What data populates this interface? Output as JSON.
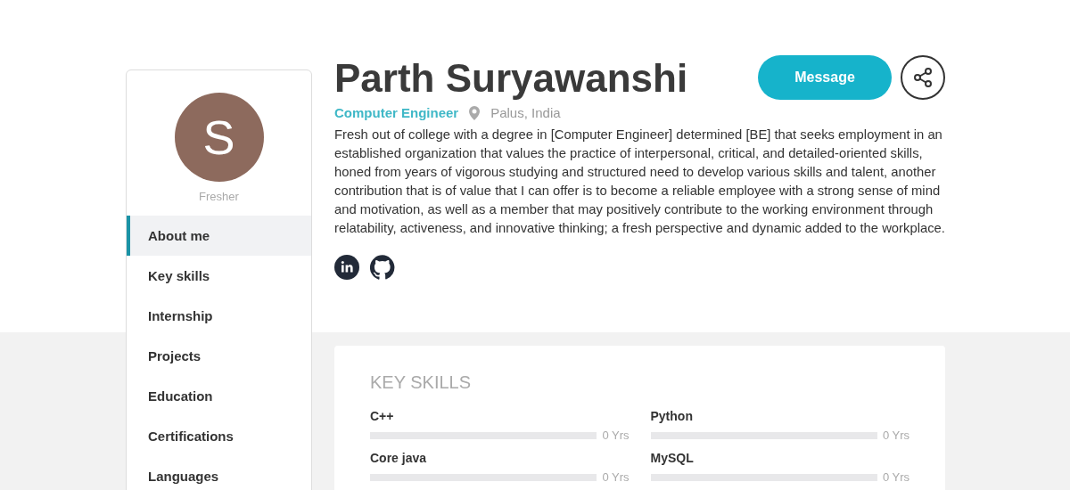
{
  "profile": {
    "avatar_letter": "S",
    "status": "Fresher",
    "name": "Parth Suryawanshi",
    "role": "Computer Engineer",
    "location": "Palus, India",
    "about": "Fresh out of college with a degree in [Computer Engineer] determined [BE] that seeks employment in an established organization that values the practice of interpersonal, critical, and detailed-oriented skills, honed from years of vigorous studying and structured need to develop various skills and talent, another contribution that is of value that I can offer is to become a reliable employee with a strong sense of mind and motivation, as well as a member that may positively contribute to the working environment through relatability, activeness, and innovative thinking; a fresh perspective and dynamic added to the workplace."
  },
  "actions": {
    "message": "Message"
  },
  "sidebar": {
    "items": [
      {
        "label": "About me",
        "selected": true
      },
      {
        "label": "Key skills",
        "selected": false
      },
      {
        "label": "Internship",
        "selected": false
      },
      {
        "label": "Projects",
        "selected": false
      },
      {
        "label": "Education",
        "selected": false
      },
      {
        "label": "Certifications",
        "selected": false
      },
      {
        "label": "Languages",
        "selected": false
      }
    ]
  },
  "key_skills": {
    "title": "KEY SKILLS",
    "skills": [
      {
        "name": "C++",
        "level": 0,
        "reading": "0 Yrs"
      },
      {
        "name": "Python",
        "level": 0,
        "reading": "0 Yrs"
      },
      {
        "name": "Core java",
        "level": 0,
        "reading": "0 Yrs"
      },
      {
        "name": "MySQL",
        "level": 0,
        "reading": "0 Yrs"
      }
    ]
  }
}
